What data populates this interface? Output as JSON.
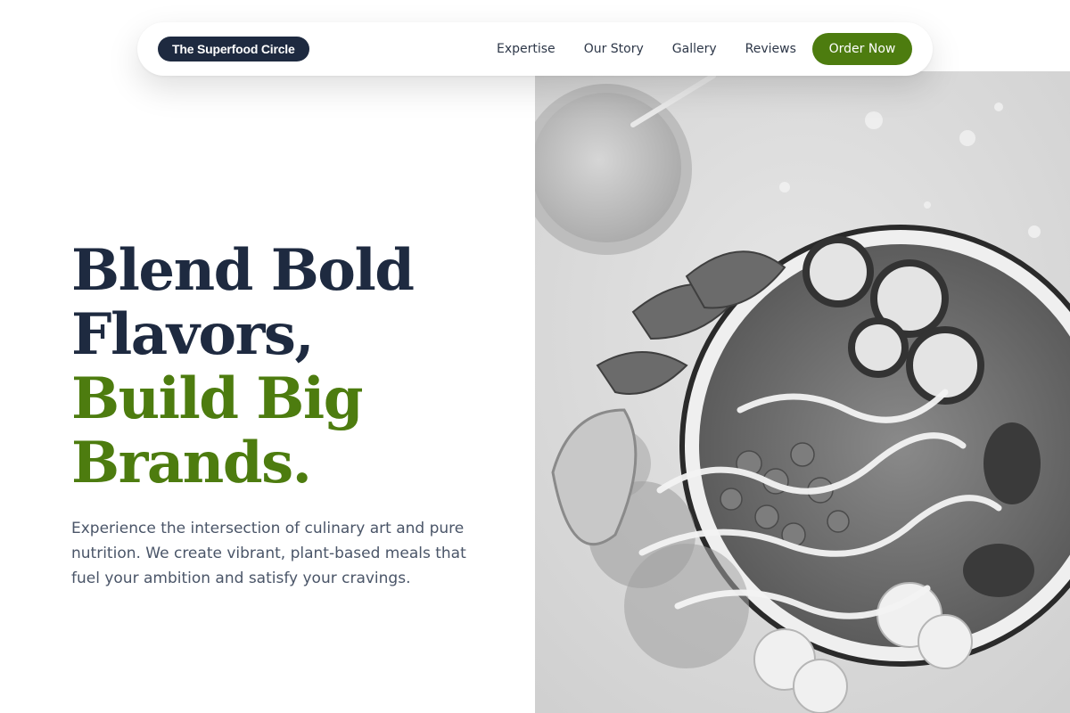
{
  "nav": {
    "brand": "The Superfood Circle",
    "links": [
      "Expertise",
      "Our Story",
      "Gallery",
      "Reviews"
    ],
    "cta": "Order Now"
  },
  "hero": {
    "headline_line1": "Blend Bold",
    "headline_line2": "Flavors,",
    "headline_line3": "Build Big",
    "headline_line4": "Brands.",
    "body": "Experience the intersection of culinary art and pure nutrition. We create vibrant, plant-based meals that fuel your ambition and satisfy your cravings."
  },
  "colors": {
    "navy": "#1e2a40",
    "brand_green": "#4d7c0f",
    "body_text": "#4a5568"
  },
  "icons": {
    "hero_image": "salad-bowl-photo"
  }
}
